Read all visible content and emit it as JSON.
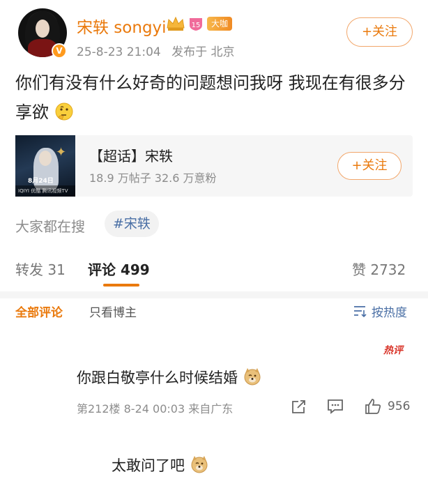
{
  "post": {
    "author": "宋轶 songyi",
    "level_badge": "15",
    "big_badge": "大咖",
    "date": "25-8-23 21:04",
    "source": "发布于 北京",
    "follow_label": "+关注",
    "text": "你们有没有什么好奇的问题想问我呀 我现在有很多分享欲",
    "emoji": "thinking-emoji"
  },
  "topic": {
    "title": "【超话】宋轶",
    "stats": "18.9 万帖子  32.6 万意粉",
    "follow_label": "+关注",
    "thumb_date": "8月24日",
    "thumb_bar": "IQIYI  优酷  腾讯视频TV"
  },
  "search": {
    "label": "大家都在搜",
    "tag": "#宋轶"
  },
  "tabs": {
    "repost": "转发 31",
    "comment": "评论 499",
    "like": "赞 2732"
  },
  "filters": {
    "all": "全部评论",
    "host_only": "只看博主",
    "sort": "按热度"
  },
  "comment": {
    "hot_badge": "热评",
    "text": "你跟白敬亭什么时候结婚",
    "meta": "第212楼  8-24 00:03  来自广东",
    "likes": "956"
  },
  "reply": {
    "text": "太敢问了吧"
  },
  "colors": {
    "accent": "#ea7a0d",
    "link": "#4a6fa5",
    "muted": "#8c8c8c"
  }
}
